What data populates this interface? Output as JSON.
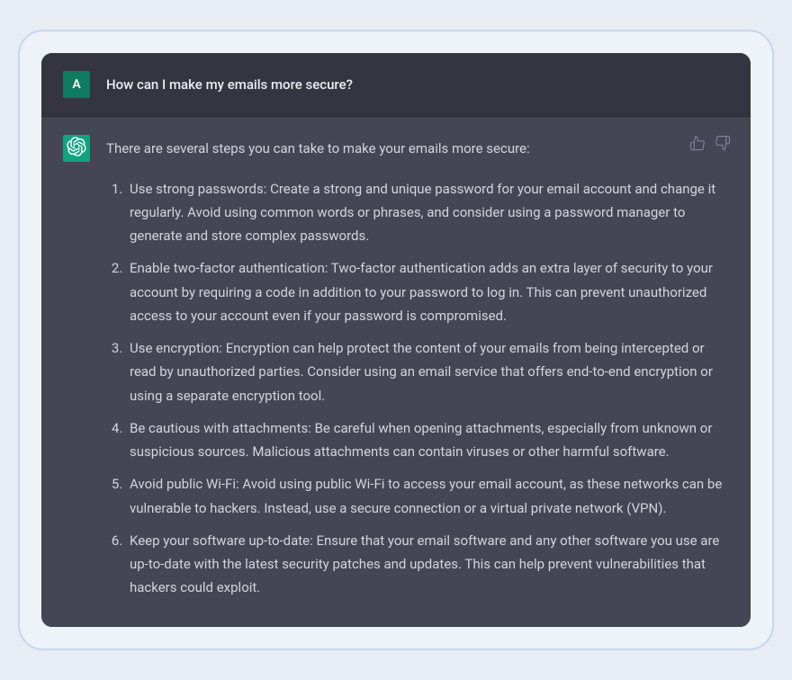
{
  "user": {
    "avatar_letter": "A",
    "message": "How can I make my emails more secure?"
  },
  "assistant": {
    "intro": "There are several steps you can take to make your emails more secure:",
    "tips": [
      "Use strong passwords: Create a strong and unique password for your email account and change it regularly. Avoid using common words or phrases, and consider using a password manager to generate and store complex passwords.",
      "Enable two-factor authentication: Two-factor authentication adds an extra layer of security to your account by requiring a code in addition to your password to log in. This can prevent unauthorized access to your account even if your password is compromised.",
      "Use encryption: Encryption can help protect the content of your emails from being intercepted or read by unauthorized parties. Consider using an email service that offers end-to-end encryption or using a separate encryption tool.",
      "Be cautious with attachments: Be careful when opening attachments, especially from unknown or suspicious sources. Malicious attachments can contain viruses or other harmful software.",
      "Avoid public Wi-Fi: Avoid using public Wi-Fi to access your email account, as these networks can be vulnerable to hackers. Instead, use a secure connection or a virtual private network (VPN).",
      "Keep your software up-to-date: Ensure that your email software and any other software you use are up-to-date with the latest security patches and updates. This can help prevent vulnerabilities that hackers could exploit."
    ]
  }
}
